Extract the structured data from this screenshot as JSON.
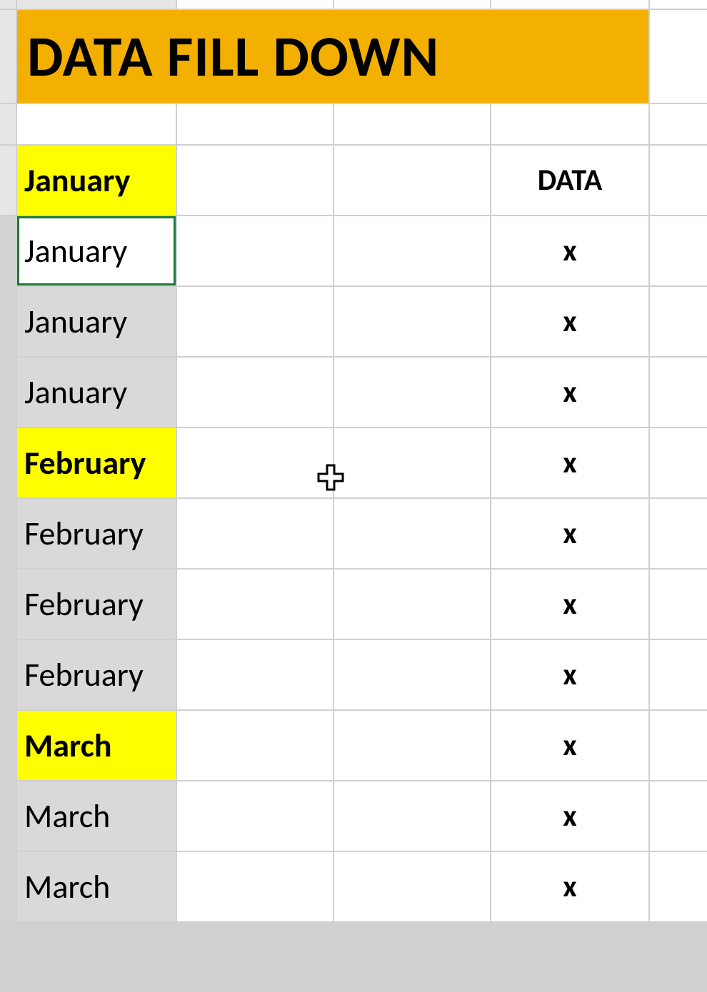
{
  "title": "DATA FILL DOWN",
  "headers": {
    "data_col": "DATA"
  },
  "rows": [
    {
      "month": "January",
      "bold": true,
      "highlight": "yellow",
      "data": "",
      "selected": false,
      "active": false
    },
    {
      "month": "January",
      "bold": false,
      "highlight": "",
      "data": "x",
      "selected": true,
      "active": true
    },
    {
      "month": "January",
      "bold": false,
      "highlight": "",
      "data": "x",
      "selected": true,
      "active": false
    },
    {
      "month": "January",
      "bold": false,
      "highlight": "",
      "data": "x",
      "selected": true,
      "active": false
    },
    {
      "month": "February",
      "bold": true,
      "highlight": "yellow",
      "data": "x",
      "selected": true,
      "active": false
    },
    {
      "month": "February",
      "bold": false,
      "highlight": "",
      "data": "x",
      "selected": true,
      "active": false
    },
    {
      "month": "February",
      "bold": false,
      "highlight": "",
      "data": "x",
      "selected": true,
      "active": false
    },
    {
      "month": "February",
      "bold": false,
      "highlight": "",
      "data": "x",
      "selected": true,
      "active": false
    },
    {
      "month": "March",
      "bold": true,
      "highlight": "yellow",
      "data": "x",
      "selected": true,
      "active": false
    },
    {
      "month": "March",
      "bold": false,
      "highlight": "",
      "data": "x",
      "selected": true,
      "active": false
    },
    {
      "month": "March",
      "bold": false,
      "highlight": "",
      "data": "x",
      "selected": true,
      "active": false
    }
  ]
}
